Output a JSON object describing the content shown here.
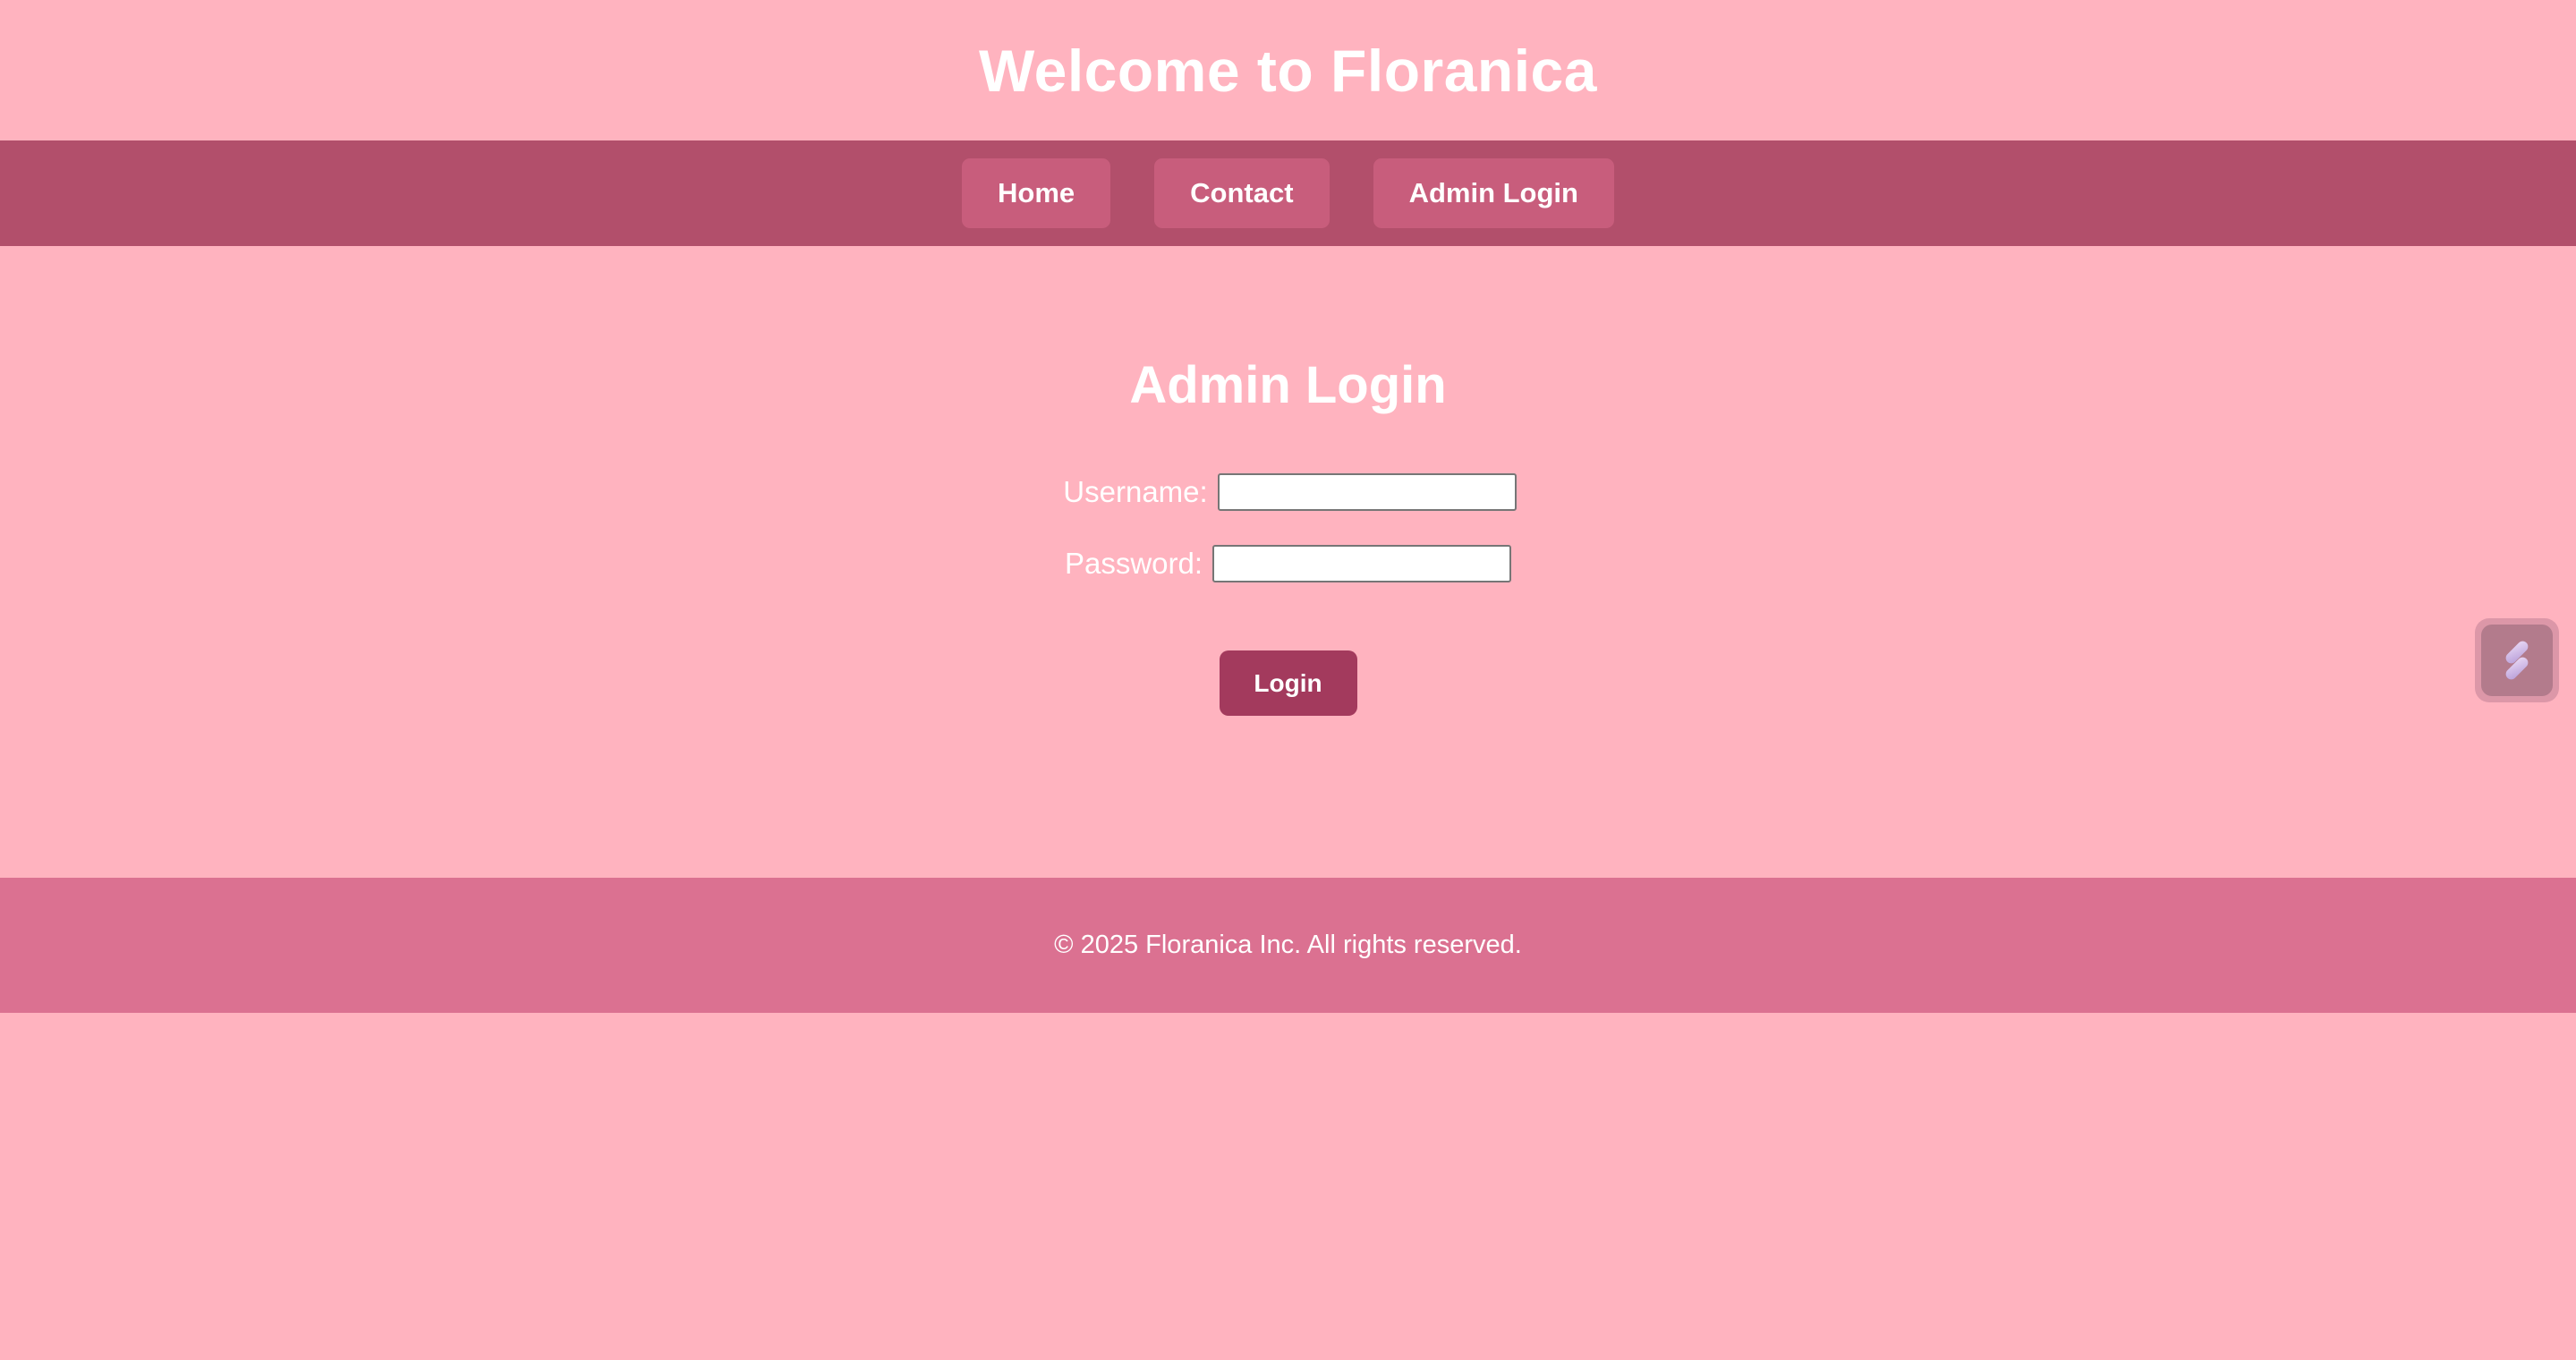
{
  "header": {
    "title": "Welcome to Floranica"
  },
  "nav": {
    "items": [
      {
        "label": "Home"
      },
      {
        "label": "Contact"
      },
      {
        "label": "Admin Login"
      }
    ]
  },
  "login": {
    "heading": "Admin Login",
    "username_label": "Username:",
    "username_value": "",
    "password_label": "Password:",
    "password_value": "",
    "submit_label": "Login"
  },
  "footer": {
    "text": "© 2025 Floranica Inc. All rights reserved."
  },
  "widget": {
    "icon": "extension-logo-icon"
  },
  "colors": {
    "page_background": "#ffb3bf",
    "nav_background": "#b24f6b",
    "nav_button": "#c85d7c",
    "login_button": "#a33a5d",
    "footer_background": "#db7191"
  }
}
